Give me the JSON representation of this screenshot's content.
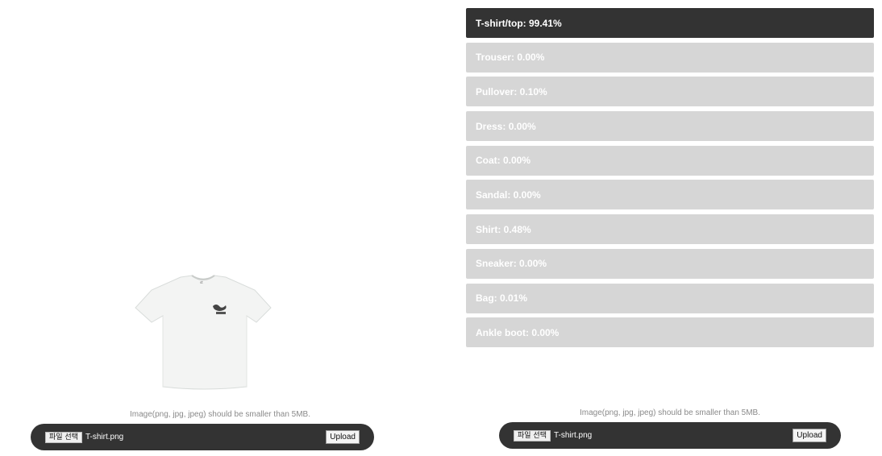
{
  "left_panel": {
    "image_alt": "T-shirt",
    "hint": "Image(png, jpg, jpeg) should be smaller than 5MB.",
    "choose_file_label": "파일 선택",
    "file_name": "T-shirt.png",
    "upload_label": "Upload"
  },
  "right_panel": {
    "hint": "Image(png, jpg, jpeg) should be smaller than 5MB.",
    "choose_file_label": "파일 선택",
    "file_name": "T-shirt.png",
    "upload_label": "Upload"
  },
  "predictions": [
    {
      "label": "T-shirt/top: 99.41%"
    },
    {
      "label": "Trouser: 0.00%"
    },
    {
      "label": "Pullover: 0.10%"
    },
    {
      "label": "Dress: 0.00%"
    },
    {
      "label": "Coat: 0.00%"
    },
    {
      "label": "Sandal: 0.00%"
    },
    {
      "label": "Shirt: 0.48%"
    },
    {
      "label": "Sneaker: 0.00%"
    },
    {
      "label": "Bag: 0.01%"
    },
    {
      "label": "Ankle boot: 0.00%"
    }
  ],
  "colors": {
    "top_prediction": "#333333",
    "other_prediction": "#d6d6d6",
    "upload_bar": "#333333"
  }
}
